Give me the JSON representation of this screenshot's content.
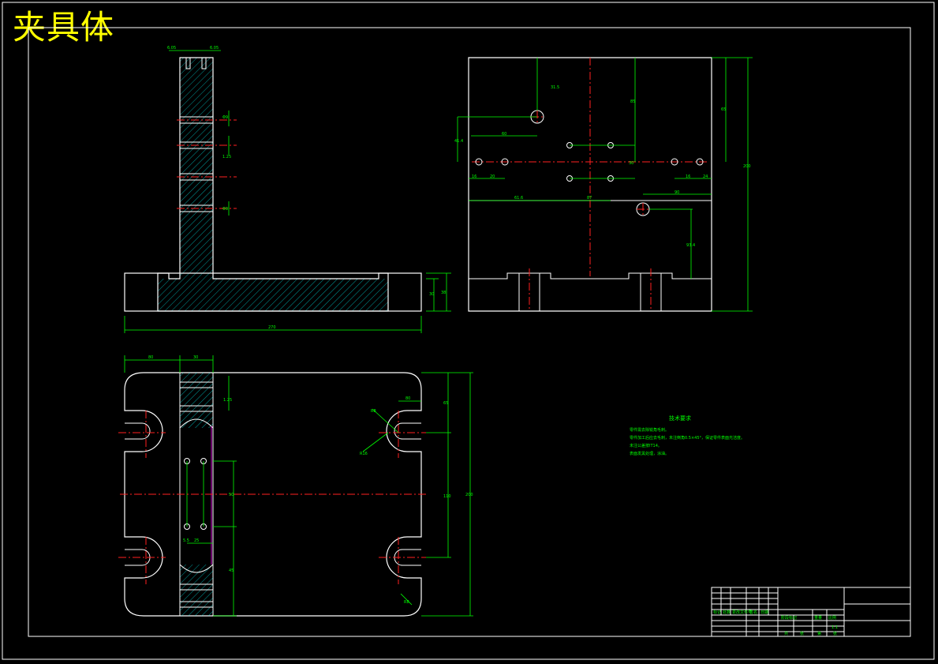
{
  "title": "夹具体",
  "colors": {
    "background": "#000000",
    "outline": "#ffffff",
    "dimension": "#00ff00",
    "centerline": "#ff2020",
    "title": "#ffff00",
    "section": "#00ffff"
  },
  "front_view": {
    "dims": {
      "base_length": "270",
      "base_height": "30",
      "base_total": "38",
      "slot_top_left": "6.05",
      "slot_top_right": "6.05",
      "hole_1": "Φ9",
      "hole_2": "1.25",
      "hole_3": "Φ9"
    }
  },
  "side_view": {
    "dims": {
      "top_offset": "31.5",
      "vertical_1": "85",
      "horizontal_1": "60",
      "left_vertical": "41.4",
      "hole_pitch": "30",
      "left_1": "16",
      "left_2": "20",
      "right_1": "16",
      "right_2": "24",
      "bottom_offset": "61.6",
      "center_87": "87",
      "right_hole_x": "90",
      "right_hole_y": "93.4",
      "total_height": "200",
      "right_vertical": "65"
    }
  },
  "top_view": {
    "dims": {
      "width_left": "80",
      "width_slot": "30",
      "slot_height": "1.25",
      "radius_1": "R8",
      "radius_2": "R16",
      "radius_3": "R8",
      "right_top": "80",
      "right_vertical": "65",
      "mid_height": "110",
      "total_height": "200",
      "bottom_left": "25",
      "bottom_left_2": "5.5",
      "bottom_left_3": "45",
      "center_mark": "50",
      "hole_5": "65"
    }
  },
  "technical_requirements": {
    "title": "技术要求",
    "items": [
      "零件需去除锐角毛刺。",
      "零件加工后应去毛刺，未注倒角0.5×45°，保证零件表面光洁度。",
      "未注公差按IT14。",
      "表面发黑处理，涂油。"
    ]
  },
  "title_block": {
    "row1": [
      "标记",
      "处数",
      "分区",
      "更改文件号",
      "签名",
      "日期"
    ],
    "row2": [
      "阶段标记",
      "重量",
      "比例"
    ],
    "row3": [
      "共",
      "张",
      "第",
      "张"
    ],
    "scale": "1:1"
  }
}
